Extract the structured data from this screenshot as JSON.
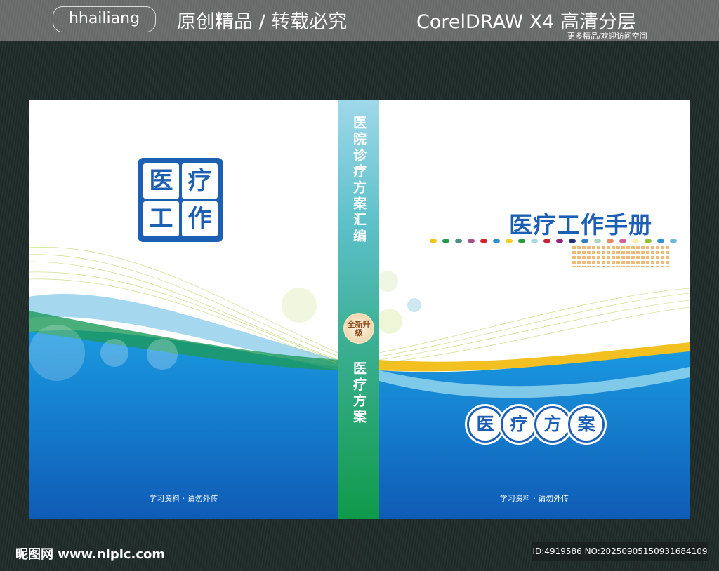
{
  "header": {
    "brand": "hhailiang",
    "slogan": "原创精品 / 转载必究",
    "tool": "CorelDRAW X4  高清分层",
    "sub": "更多精品/欢迎访问空间"
  },
  "back_cover": {
    "stamp": [
      "医",
      "疗",
      "工",
      "作"
    ],
    "footer": "学习资料 · 请勿外传"
  },
  "spine": {
    "title": "医院诊疗方案汇编",
    "badge": "全新升级",
    "subtitle": "医疗方案"
  },
  "front_cover": {
    "title": "医疗工作手册",
    "circles": [
      "医",
      "疗",
      "方",
      "案"
    ],
    "footer": "学习资料 · 请勿外传",
    "dot_colors": [
      "#f2c319",
      "#1f9a4a",
      "#4f8f80",
      "#a4508e",
      "#d6202c",
      "#2f8fd0",
      "#f2d020",
      "#2a9a3a",
      "#a8d8e8",
      "#c8203a",
      "#9a2080",
      "#1f2f7a",
      "#2f7fc0",
      "#a8d8b8",
      "#e88a60",
      "#d060a0",
      "#f8f0b0",
      "#90c040",
      "#3090d0",
      "#70b8d8"
    ]
  },
  "footer": {
    "watermark": "昵图网 www.nipic.com",
    "id": "ID:4919586 NO:20250905150931684109"
  }
}
